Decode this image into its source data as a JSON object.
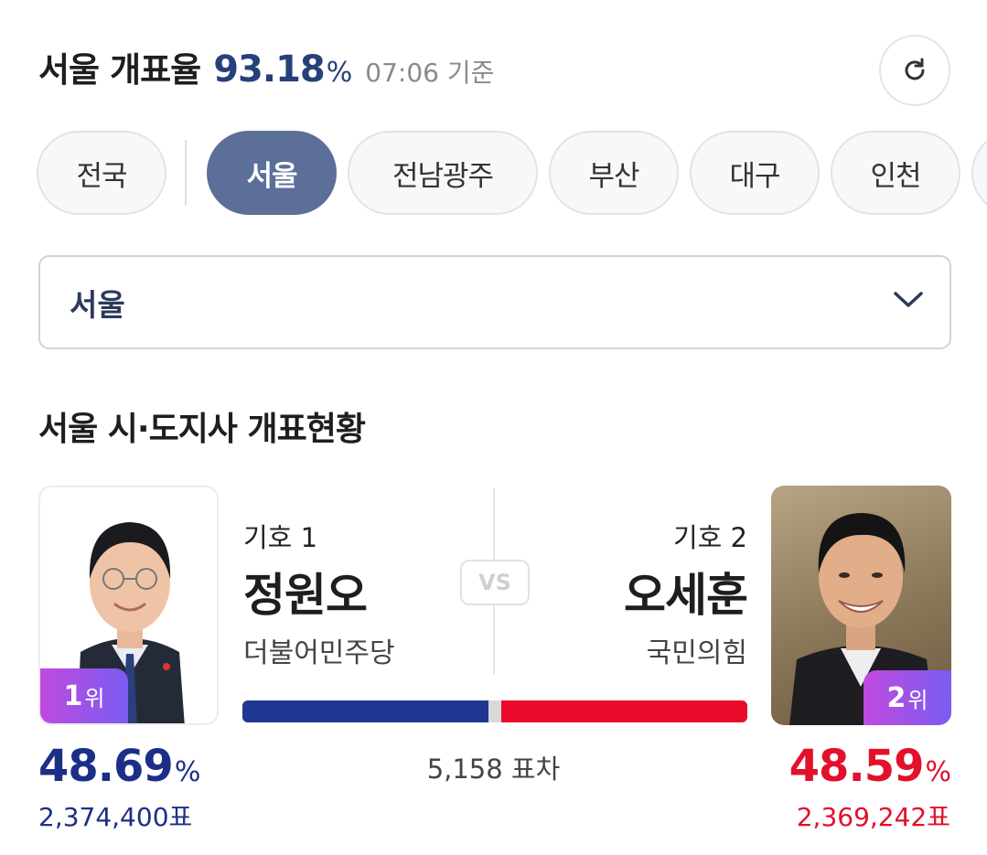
{
  "header": {
    "region": "서울",
    "label": "개표율",
    "rate": "93.18",
    "rate_unit": "%",
    "time": "07:06 기준"
  },
  "tabs": [
    "전국",
    "서울",
    "전남광주",
    "부산",
    "대구",
    "인천"
  ],
  "active_tab": "서울",
  "select": {
    "value": "서울"
  },
  "section_title": "서울 시·도지사 개표현황",
  "candidates": {
    "left": {
      "number": "기호 1",
      "name": "정원오",
      "party": "더불어민주당",
      "rank_num": "1",
      "rank_suffix": "위",
      "percent": "48.69",
      "percent_unit": "%",
      "votes": "2,374,400표",
      "color": "#1c2f86"
    },
    "right": {
      "number": "기호 2",
      "name": "오세훈",
      "party": "국민의힘",
      "rank_num": "2",
      "rank_suffix": "위",
      "percent": "48.59",
      "percent_unit": "%",
      "votes": "2,369,242표",
      "color": "#e2102b"
    }
  },
  "vs_label": "VS",
  "margin_text": "5,158 표차",
  "icons": [
    "refresh-icon",
    "chevron-down-icon"
  ]
}
